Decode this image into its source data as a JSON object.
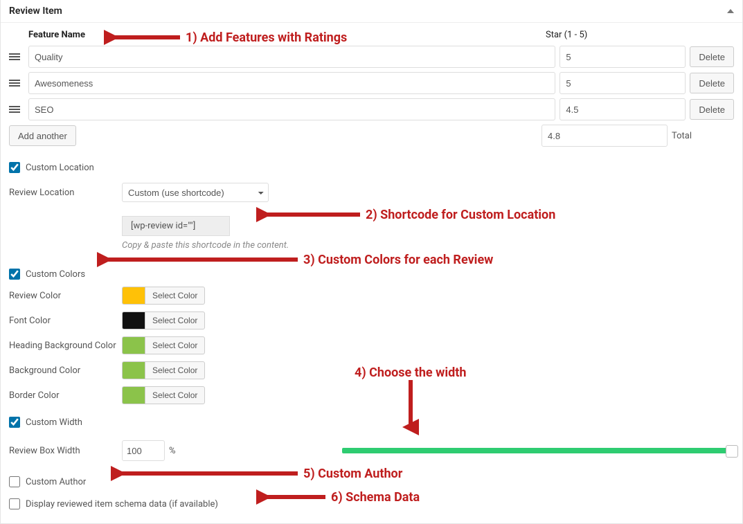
{
  "panel": {
    "title": "Review Item"
  },
  "features": {
    "name_header": "Feature Name",
    "star_header": "Star (1 - 5)",
    "rows": [
      {
        "name": "Quality",
        "star": "5"
      },
      {
        "name": "Awesomeness",
        "star": "5"
      },
      {
        "name": "SEO",
        "star": "4.5"
      }
    ],
    "delete_label": "Delete",
    "add_label": "Add another",
    "total_value": "4.8",
    "total_label": "Total"
  },
  "custom_location": {
    "checkbox_label": "Custom Location",
    "checked": true,
    "row_label": "Review Location",
    "select_value": "Custom (use shortcode)",
    "shortcode": "[wp-review id=\"\"]",
    "help": "Copy & paste this shortcode in the content."
  },
  "custom_colors": {
    "checkbox_label": "Custom Colors",
    "checked": true,
    "select_color_label": "Select Color",
    "rows": [
      {
        "label": "Review Color",
        "hex": "#ffc107"
      },
      {
        "label": "Font Color",
        "hex": "#111111"
      },
      {
        "label": "Heading Background Color",
        "hex": "#8bc34a"
      },
      {
        "label": "Background Color",
        "hex": "#8bc34a"
      },
      {
        "label": "Border Color",
        "hex": "#8bc34a"
      }
    ]
  },
  "custom_width": {
    "checkbox_label": "Custom Width",
    "checked": true,
    "row_label": "Review Box Width",
    "value": "100",
    "unit": "%"
  },
  "custom_author": {
    "checkbox_label": "Custom Author",
    "checked": false
  },
  "schema": {
    "checkbox_label": "Display reviewed item schema data (if available)",
    "checked": false
  },
  "annotations": {
    "a1": "1) Add Features with Ratings",
    "a2": "2) Shortcode for Custom Location",
    "a3": "3) Custom Colors for each Review",
    "a4": "4) Choose the width",
    "a5": "5) Custom Author",
    "a6": "6) Schema Data"
  }
}
